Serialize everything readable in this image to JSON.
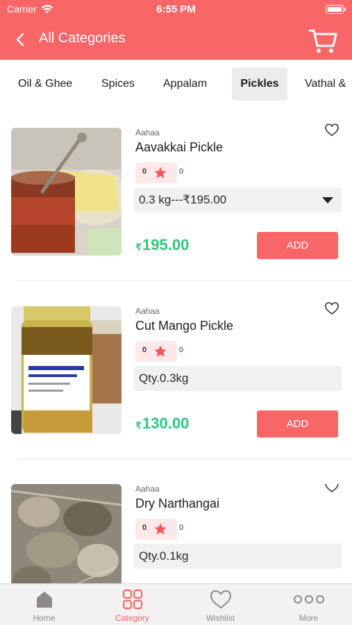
{
  "status": {
    "carrier": "Carrier",
    "time": "6:55 PM"
  },
  "header": {
    "title": "All Categories"
  },
  "tabs": [
    {
      "label": "Oil & Ghee",
      "active": false
    },
    {
      "label": "Spices",
      "active": false
    },
    {
      "label": "Appalam",
      "active": false
    },
    {
      "label": "Pickles",
      "active": true
    },
    {
      "label": "Vathal &",
      "active": false
    }
  ],
  "products": [
    {
      "brand": "Aahaa",
      "name": "Aavakkai Pickle",
      "rating": "0",
      "reviews": "0",
      "variant": "0.3 kg---₹195.00",
      "variant_is_select": true,
      "currency": "₹",
      "price": "195.00",
      "add_label": "ADD"
    },
    {
      "brand": "Aahaa",
      "name": "Cut Mango Pickle",
      "rating": "0",
      "reviews": "0",
      "variant": "Qty.0.3kg",
      "variant_is_select": false,
      "currency": "₹",
      "price": "130.00",
      "add_label": "ADD"
    },
    {
      "brand": "Aahaa",
      "name": "Dry Narthangai",
      "rating": "0",
      "reviews": "0",
      "variant": "Qty.0.1kg",
      "variant_is_select": false,
      "currency": "",
      "price": "",
      "add_label": ""
    }
  ],
  "tabbar": [
    {
      "label": "Home",
      "icon": "home-icon",
      "active": false
    },
    {
      "label": "Category",
      "icon": "grid-icon",
      "active": true
    },
    {
      "label": "Wishlist",
      "icon": "heart-icon",
      "active": false
    },
    {
      "label": "More",
      "icon": "more-icon",
      "active": false
    }
  ],
  "colors": {
    "brand": "#f96667",
    "price": "#2dc77e",
    "rating_bg": "#fde9e9"
  }
}
